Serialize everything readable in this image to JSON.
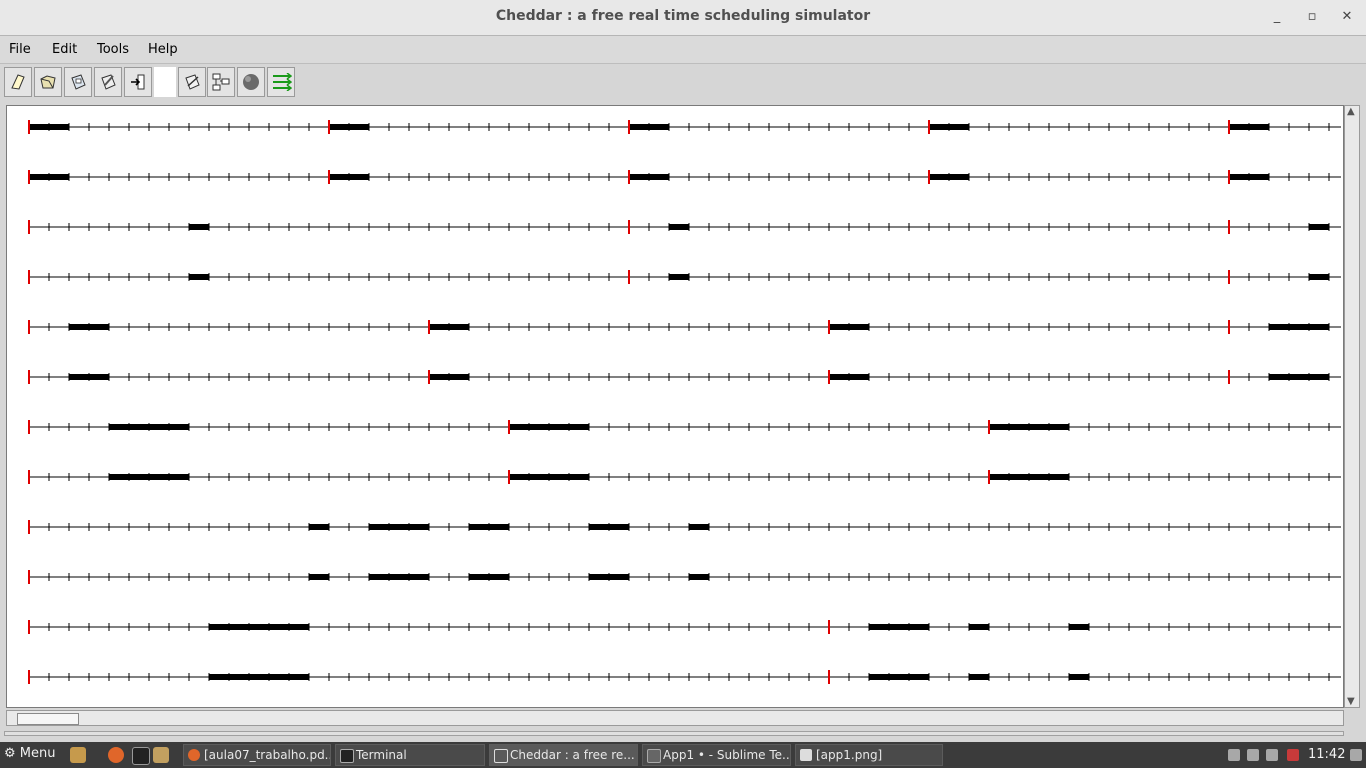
{
  "window": {
    "title": "Cheddar : a free real time scheduling simulator"
  },
  "menubar": {
    "items": [
      "File",
      "Edit",
      "Tools",
      "Help"
    ]
  },
  "toolbar": {
    "buttons": [
      "new-file-icon",
      "open-file-icon",
      "save-file-icon",
      "edit-file-icon",
      "exit-icon",
      "edit-system-icon",
      "architecture-icon",
      "sphere-icon",
      "schedule-arrows-icon"
    ]
  },
  "timeline": {
    "rows": 12,
    "tick_count": 66,
    "release_color": "#e00000",
    "exec_color": "#000000",
    "row_groups": [
      {
        "releases": [
          0,
          15,
          30,
          45,
          60
        ],
        "exec": [
          [
            0,
            2
          ],
          [
            15,
            17
          ],
          [
            30,
            32
          ],
          [
            45,
            47
          ],
          [
            60,
            62
          ]
        ]
      },
      {
        "releases": [
          0,
          30,
          60
        ],
        "exec": [
          [
            8,
            9
          ],
          [
            32,
            33
          ],
          [
            64,
            65
          ]
        ]
      },
      {
        "releases": [
          0,
          20,
          40,
          60
        ],
        "exec": [
          [
            2,
            4
          ],
          [
            20,
            22
          ],
          [
            40,
            42
          ],
          [
            62,
            65
          ]
        ]
      },
      {
        "releases": [
          0,
          24,
          48
        ],
        "exec": [
          [
            4,
            8
          ],
          [
            24,
            28
          ],
          [
            48,
            52
          ]
        ]
      },
      {
        "releases": [
          0
        ],
        "exec": [
          [
            14,
            15
          ],
          [
            17,
            20
          ],
          [
            22,
            24
          ],
          [
            28,
            30
          ],
          [
            33,
            34
          ]
        ]
      },
      {
        "releases": [
          0,
          40
        ],
        "exec": [
          [
            9,
            14
          ],
          [
            42,
            45
          ],
          [
            47,
            48
          ],
          [
            52,
            53
          ]
        ]
      }
    ]
  },
  "taskbar": {
    "menu_label": "Menu",
    "windows": [
      "[aula07_trabalho.pd...",
      "Terminal",
      "Cheddar : a free re...",
      "App1 • - Sublime Te...",
      "[app1.png]"
    ],
    "clock": "11:42"
  }
}
